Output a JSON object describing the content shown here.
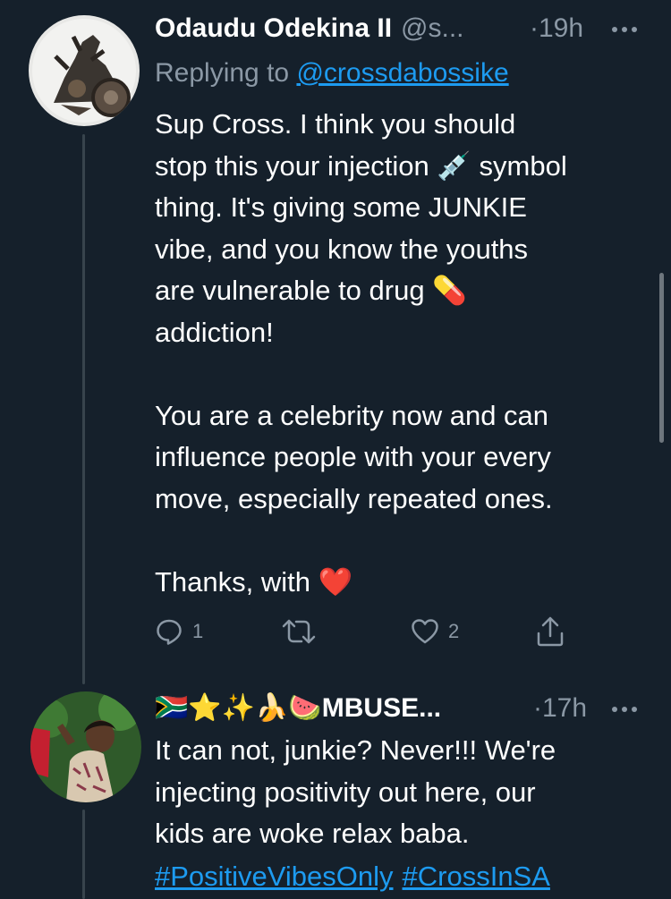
{
  "tweet1": {
    "display_name": "Odaudu Odekina II",
    "handle": "@s...",
    "time": "·19h",
    "reply_prefix": "Replying to",
    "reply_handle": "@crossdabossike",
    "lines": [
      "Sup Cross. I think you should",
      "stop this your injection 💉 symbol",
      "thing. It's giving some JUNKIE",
      "vibe, and you know the youths",
      "are vulnerable to drug 💊",
      "addiction!",
      "",
      "You are a celebrity now and can",
      "influence people with your every",
      "move, especially repeated ones.",
      "",
      "Thanks, with ❤️"
    ],
    "reply_count": "1",
    "like_count": "2"
  },
  "tweet2": {
    "display_name": "🇿🇦⭐✨🍌🍉MBUSE...",
    "time": "·17h",
    "lines": [
      "It can not, junkie? Never!!! We're",
      "injecting positivity out here, our",
      "kids are woke relax baba."
    ],
    "hashtags": [
      "#PositiveVibesOnly",
      "#CrossInSA"
    ]
  },
  "icons": {
    "reply": "reply-icon",
    "retweet": "retweet-icon",
    "like": "heart-icon",
    "share": "share-icon",
    "more": "more-icon"
  },
  "colors": {
    "background": "#15202b",
    "text": "#ffffff",
    "muted": "#8b98a5",
    "link": "#1d9bf0",
    "thread_line": "#38444d"
  }
}
